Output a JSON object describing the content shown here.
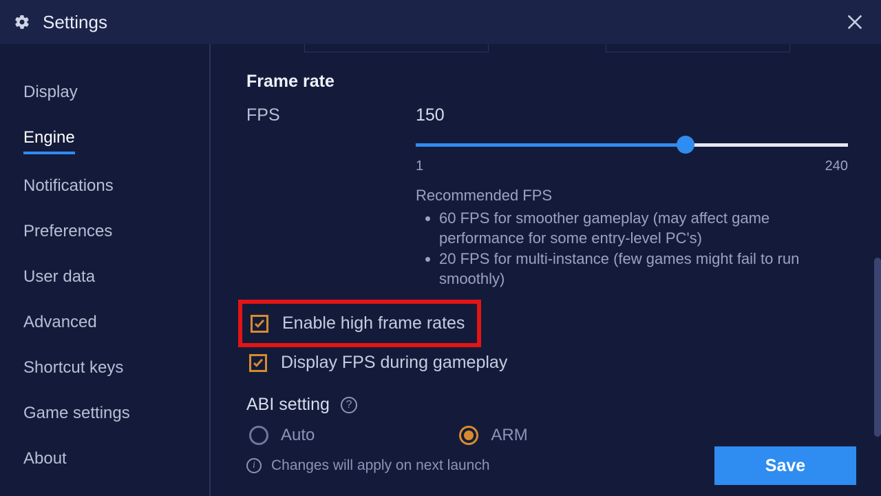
{
  "header": {
    "title": "Settings"
  },
  "sidebar": {
    "items": [
      {
        "label": "Display"
      },
      {
        "label": "Engine",
        "active": true
      },
      {
        "label": "Notifications"
      },
      {
        "label": "Preferences"
      },
      {
        "label": "User data"
      },
      {
        "label": "Advanced"
      },
      {
        "label": "Shortcut keys"
      },
      {
        "label": "Game settings"
      },
      {
        "label": "About"
      }
    ]
  },
  "frame_rate": {
    "heading": "Frame rate",
    "fps_label": "FPS",
    "fps_value": "150",
    "slider": {
      "min": 1,
      "max": 240,
      "value": 150,
      "min_label": "1",
      "max_label": "240"
    },
    "recommended_title": "Recommended FPS",
    "recommended": [
      "60 FPS for smoother gameplay (may affect game performance for some entry-level PC's)",
      "20 FPS for multi-instance (few games might fail to run smoothly)"
    ],
    "enable_high_label": "Enable high frame rates",
    "enable_high_checked": true,
    "display_fps_label": "Display FPS during gameplay",
    "display_fps_checked": true
  },
  "abi": {
    "heading": "ABI setting",
    "options": [
      {
        "label": "Auto",
        "selected": false
      },
      {
        "label": "ARM",
        "selected": true
      }
    ]
  },
  "footer": {
    "note": "Changes will apply on next launch",
    "save_label": "Save"
  },
  "colors": {
    "accent": "#2f8cf0",
    "checkbox": "#d78b2f",
    "highlight": "#e31414",
    "bg": "#141b3a",
    "header_bg": "#1b2348"
  }
}
